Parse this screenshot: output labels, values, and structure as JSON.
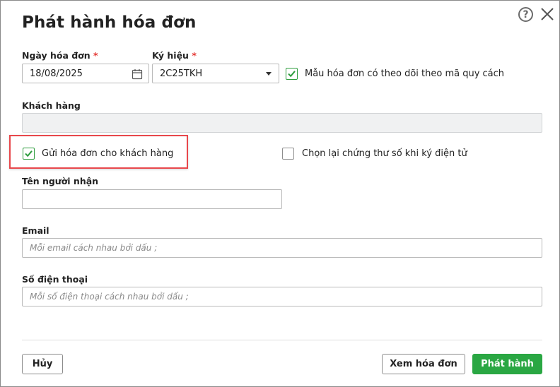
{
  "dialog": {
    "title": "Phát hành hóa đơn"
  },
  "invoice_date": {
    "label": "Ngày hóa đơn",
    "required_mark": "*",
    "value": "18/08/2025"
  },
  "symbol": {
    "label": "Ký hiệu",
    "required_mark": "*",
    "value": "2C25TKH"
  },
  "track_by_spec": {
    "label": "Mẫu hóa đơn có theo dõi theo mã quy cách",
    "checked": true
  },
  "customer": {
    "label": "Khách hàng",
    "value": ""
  },
  "send_to_customer": {
    "label": "Gửi hóa đơn cho khách hàng",
    "checked": true
  },
  "reselect_certificate": {
    "label": "Chọn lại chứng thư số khi ký điện tử",
    "checked": false
  },
  "recipient_name": {
    "label": "Tên người nhận",
    "value": ""
  },
  "email": {
    "label": "Email",
    "placeholder": "Mỗi email cách nhau bởi dấu ;"
  },
  "phone": {
    "label": "Số điện thoại",
    "placeholder": "Mỗi số điện thoại cách nhau bởi dấu ;"
  },
  "buttons": {
    "cancel": "Hủy",
    "view": "Xem hóa đơn",
    "issue": "Phát hành"
  },
  "icons": {
    "help": "help-icon",
    "close": "close-icon",
    "calendar": "calendar-icon",
    "dropdown": "chevron-down-icon",
    "check": "check-icon"
  },
  "colors": {
    "accent": "#2aa743",
    "highlight": "#e8474b",
    "required": "#e53935"
  }
}
